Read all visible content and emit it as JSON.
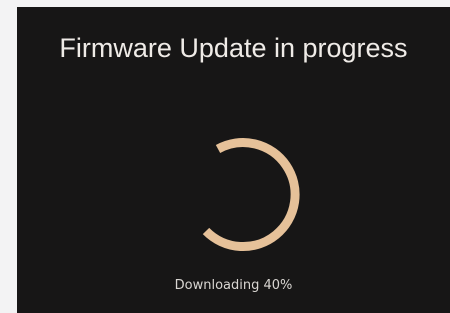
{
  "update": {
    "title": "Firmware Update in progress",
    "status_text": "Downloading 40%",
    "progress_percent": 40
  },
  "colors": {
    "background": "#171616",
    "spinner": "#e6c199",
    "title_text": "#efebe7",
    "status_text": "#d9d6d2"
  },
  "icons": {
    "spinner": "loading-spinner-icon"
  }
}
